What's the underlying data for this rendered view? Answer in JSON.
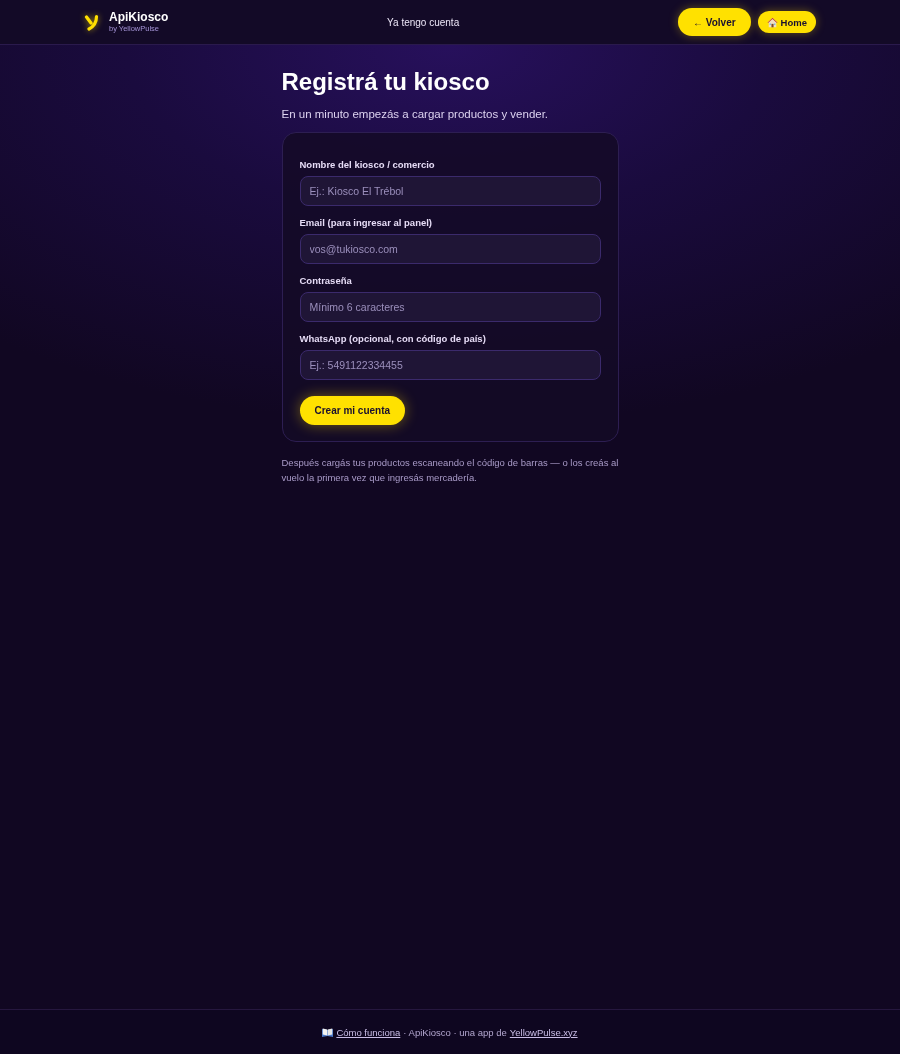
{
  "header": {
    "brand": {
      "name": "ApiKiosco",
      "byline": "by YellowPulse"
    },
    "nav_link": "Ya tengo cuenta",
    "buttons": [
      {
        "label": "← Volver",
        "kind": "back"
      },
      {
        "label": "Home",
        "kind": "home"
      }
    ]
  },
  "page": {
    "title": "Registrá tu kiosco",
    "subtitle": "En un minuto empezás a cargar productos y vender."
  },
  "form": {
    "fields": [
      {
        "label": "Nombre del kiosco / comercio",
        "placeholder": "Ej.: Kiosco El Trébol"
      },
      {
        "label": "Email (para ingresar al panel)",
        "placeholder": "vos@tukiosco.com"
      },
      {
        "label": "Contraseña",
        "placeholder": "Mínimo 6 caracteres"
      },
      {
        "label": "WhatsApp (opcional, con código de país)",
        "placeholder": "Ej.: 5491122334455"
      }
    ],
    "submit": "Crear mi cuenta"
  },
  "note": "Después cargás tus productos escaneando el código de barras — o los creás al vuelo la primera vez que ingresás mercadería.",
  "footer": {
    "help_link": "Cómo funciona",
    "text": "· ApiKiosco · una app de",
    "site_link": "YellowPulse.xyz"
  }
}
